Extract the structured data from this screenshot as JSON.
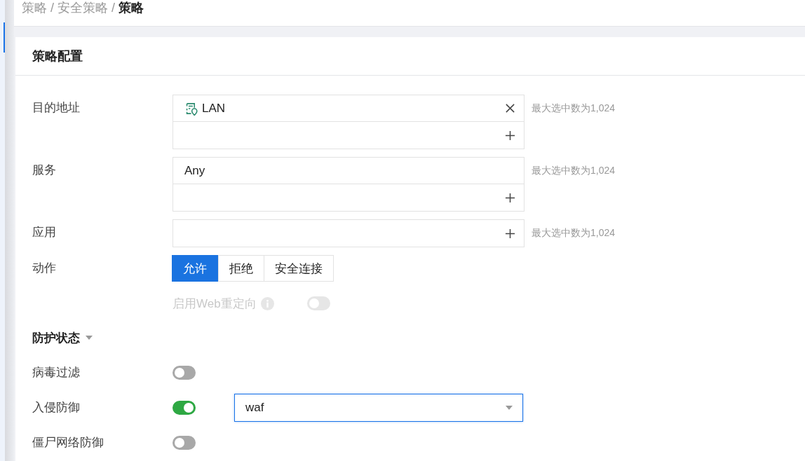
{
  "breadcrumb": {
    "separator": "/",
    "items": [
      {
        "label": "策略",
        "current": false
      },
      {
        "label": "安全策略",
        "current": false
      },
      {
        "label": "策略",
        "current": true
      }
    ]
  },
  "card": {
    "title": "策略配置"
  },
  "form": [
    {
      "kind": "list",
      "label": "目的地址",
      "items": [
        {
          "kind": "address",
          "text": "LAN",
          "removable": true
        }
      ],
      "hint": "最大选中数为1,024"
    },
    {
      "kind": "list",
      "label": "服务",
      "items": [
        {
          "kind": "service",
          "text": "Any",
          "removable": false
        }
      ],
      "hint": "最大选中数为1,024"
    },
    {
      "kind": "list",
      "label": "应用",
      "hint": "最大选中数为1,024"
    },
    {
      "kind": "segmented",
      "label": "动作",
      "options": [
        {
          "label": "允许",
          "selected": true
        },
        {
          "label": "拒绝",
          "selected": false
        },
        {
          "label": "安全连接",
          "selected": false
        }
      ]
    },
    {
      "kind": "switch",
      "label": "启用Web重定向",
      "info": true,
      "disabled": true,
      "on": false
    }
  ],
  "protection": {
    "title": "防护状态",
    "expanded": true,
    "items": [
      {
        "label": "病毒过滤",
        "on": false
      },
      {
        "label": "入侵防御",
        "on": true,
        "profile": {
          "value": "waf",
          "focused": true
        }
      },
      {
        "label": "僵尸网络防御",
        "on": false
      }
    ]
  }
}
